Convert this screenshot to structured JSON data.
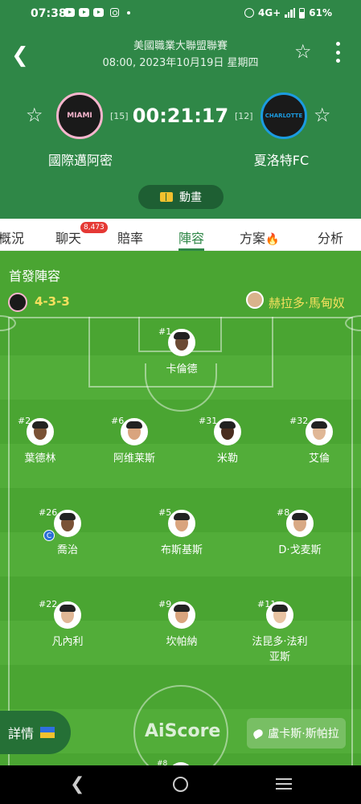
{
  "status_bar": {
    "time": "07:38",
    "network": "4G+",
    "battery": "61%"
  },
  "header": {
    "league": "美國職業大聯盟聯賽",
    "date": "08:00, 2023年10月19日 星期四",
    "clock": "00:21:17",
    "home": {
      "name": "國際邁阿密",
      "rank": "[15]",
      "logo_text": "MIAMI"
    },
    "away": {
      "name": "夏洛特FC",
      "rank": "[12]",
      "logo_text": "CHARLOTTE"
    },
    "animation_label": "動畫"
  },
  "tabs": [
    {
      "label": "概況"
    },
    {
      "label": "聊天",
      "badge": "8,473"
    },
    {
      "label": "賠率"
    },
    {
      "label": "陣容",
      "active": true
    },
    {
      "label": "方案"
    },
    {
      "label": "分析"
    }
  ],
  "lineup": {
    "title": "首發陣容",
    "formation": "4-3-3",
    "coach": "赫拉多·馬甸奴",
    "players": [
      {
        "number": "#1",
        "name": "卡倫德"
      },
      {
        "number": "#2",
        "name": "葉德林"
      },
      {
        "number": "#6",
        "name": "阿维莱斯"
      },
      {
        "number": "#31",
        "name": "米勒"
      },
      {
        "number": "#32",
        "name": "艾倫"
      },
      {
        "number": "#26",
        "name": "喬治",
        "captain": "C"
      },
      {
        "number": "#5",
        "name": "布斯基斯"
      },
      {
        "number": "#8",
        "name": "D·戈麦斯"
      },
      {
        "number": "#22",
        "name": "凡內利"
      },
      {
        "number": "#9",
        "name": "坎帕納"
      },
      {
        "number": "#11",
        "name": "法昆多·法利亚斯"
      }
    ],
    "partial_number": "#8",
    "details_label": "詳情",
    "watermark": "AiScore",
    "referee": "盧卡斯·斯帕拉"
  },
  "colors": {
    "header_green": "#2f8747",
    "pitch_green": "#4aa532",
    "formation_yellow": "#f6e05e",
    "active_tab": "#2f8747"
  }
}
